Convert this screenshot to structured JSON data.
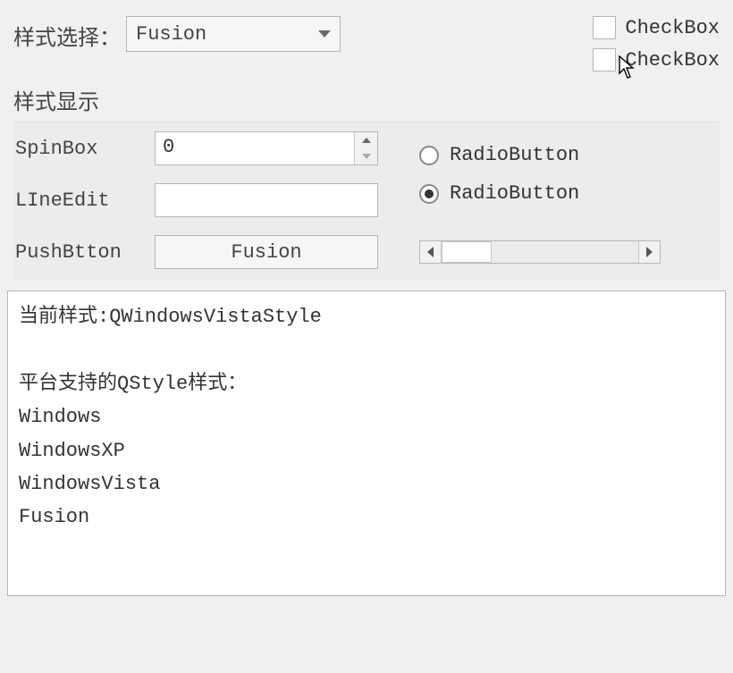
{
  "top": {
    "style_select_label": "样式选择：",
    "combo_value": "Fusion",
    "checkbox_label_1": "CheckBox",
    "checkbox_label_2": "CheckBox"
  },
  "section_title": "样式显示",
  "form": {
    "spinbox_label": "SpinBox",
    "spinbox_value": "0",
    "lineedit_label": "LIneEdit",
    "lineedit_value": "",
    "pushbutton_label": "PushBtton",
    "pushbutton_text": "Fusion",
    "radio_label_1": "RadioButton",
    "radio_label_2": "RadioButton"
  },
  "textarea": "当前样式:QWindowsVistaStyle\n\n平台支持的QStyle样式：\nWindows\nWindowsXP\nWindowsVista\nFusion"
}
